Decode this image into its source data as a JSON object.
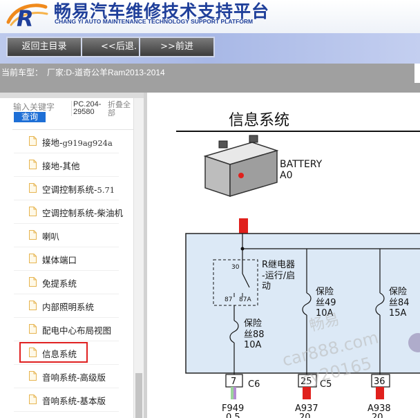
{
  "header": {
    "title_cn": "畅易汽车维修技术支持平台",
    "title_en": "CHANG YI AUTO MAINTENANCE TECHNOLOGY SUPPORT PLATFORM",
    "logo_letter": "R"
  },
  "nav": {
    "home": "返回主目录",
    "back": "<<后退.",
    "forward": ">>前进"
  },
  "vehicle": {
    "label": "当前车型：",
    "value": "厂家:D-道奇公羊Ram2013-2014"
  },
  "search": {
    "label": "输入关键字",
    "button": "查询",
    "pc_code": "PC.204-29580",
    "fold_all": "折叠全部"
  },
  "tree": {
    "items": [
      {
        "label": "接地-",
        "code": "g919ag924a"
      },
      {
        "label": "接地-其他",
        "code": ""
      },
      {
        "label": "空调控制系统-",
        "code": "5.71"
      },
      {
        "label": "空调控制系统-柴油机",
        "code": ""
      },
      {
        "label": "喇叭",
        "code": ""
      },
      {
        "label": "媒体端口",
        "code": ""
      },
      {
        "label": "免提系统",
        "code": ""
      },
      {
        "label": "内部照明系统",
        "code": ""
      },
      {
        "label": "配电中心布局视图",
        "code": ""
      },
      {
        "label": "信息系统",
        "code": ""
      },
      {
        "label": "音响系统-高级版",
        "code": ""
      },
      {
        "label": "音响系统-基本版",
        "code": ""
      }
    ],
    "selected_index": 9
  },
  "diagram": {
    "title": "信息系统",
    "battery_label": "BATTERY",
    "battery_code": "A0",
    "relay_label_1": "R继电器",
    "relay_label_2": "-运行/启",
    "relay_label_3": "动",
    "relay_pin_30": "30",
    "relay_pin_87": "87",
    "relay_pin_87a": "87A",
    "fuse1_line1": "保险",
    "fuse1_line2": "丝88",
    "fuse1_line3": "10A",
    "fuse2_line1": "保险",
    "fuse2_line2": "丝49",
    "fuse2_line3": "10A",
    "fuse3_line1": "保险",
    "fuse3_line2": "丝84",
    "fuse3_line3": "15A",
    "conn1_pin": "7",
    "conn1_name": "C6",
    "conn2_pin": "25",
    "conn2_name": "C5",
    "conn3_pin": "36",
    "wire1_code": "F949",
    "wire1_size": "0.5",
    "wire2_code": "A937",
    "wire2_size": "20",
    "wire3_code": "A938",
    "wire3_size": "20",
    "watermark_1": "畅易",
    "watermark_2": "car888.com",
    "watermark_3": "cy20165"
  },
  "colors": {
    "brand_blue": "#1f3f9a",
    "nav_bg": "#aebde8",
    "selection_red": "#e02020",
    "fuse_box_fill": "#dce9f6",
    "wire_red": "#e0201c"
  }
}
